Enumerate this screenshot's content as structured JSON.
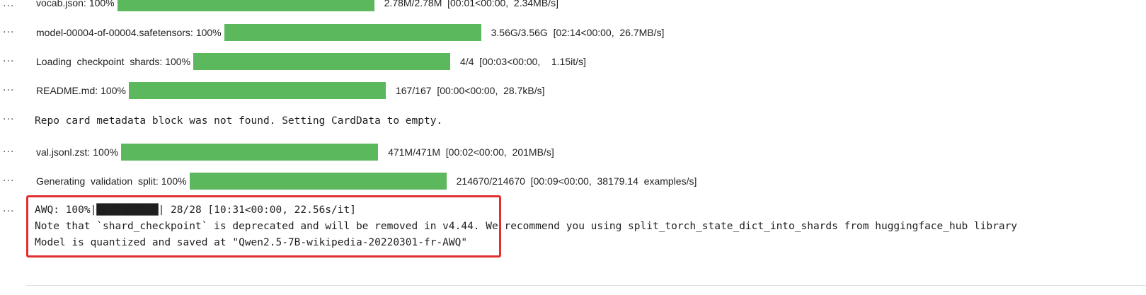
{
  "cells": [
    {
      "type": "progress",
      "desc": "vocab.json:",
      "pct": "100%",
      "progress": 1.0,
      "stats": "2.78M/2.78M  [00:01<00:00,  2.34MB/s]"
    },
    {
      "type": "progress",
      "desc": "model-00004-of-00004.safetensors:",
      "pct": "100%",
      "progress": 1.0,
      "stats": "3.56G/3.56G  [02:14<00:00,  26.7MB/s]"
    },
    {
      "type": "progress",
      "desc": "Loading  checkpoint  shards:",
      "pct": "100%",
      "progress": 1.0,
      "stats": "4/4  [00:03<00:00,    1.15it/s]"
    },
    {
      "type": "progress",
      "desc": "README.md:",
      "pct": "100%",
      "progress": 1.0,
      "stats": "167/167  [00:00<00:00,  28.7kB/s]"
    },
    {
      "type": "text",
      "text": "Repo card metadata block was not found. Setting CardData to empty."
    },
    {
      "type": "progress",
      "desc": "val.jsonl.zst:",
      "pct": "100%",
      "progress": 1.0,
      "stats": "471M/471M  [00:02<00:00,  201MB/s]"
    },
    {
      "type": "progress",
      "desc": "Generating  validation  split:",
      "pct": "100%",
      "progress": 1.0,
      "stats": "214670/214670  [00:09<00:00,  38179.14  examples/s]"
    }
  ],
  "last_output": {
    "line1": "AWQ: 100%|██████████| 28/28 [10:31<00:00, 22.56s/it]",
    "line2": "Note that `shard_checkpoint` is deprecated and will be removed in v4.44. We recommend you using split_torch_state_dict_into_shards from huggingface_hub library",
    "line3": "Model is quantized and saved at \"Qwen2.5-7B-wikipedia-20220301-fr-AWQ\""
  },
  "icons": {
    "more": "more-horizontal-icon"
  },
  "colors": {
    "bar_fill": "#5cb85c",
    "highlight_border": "#e03030"
  }
}
